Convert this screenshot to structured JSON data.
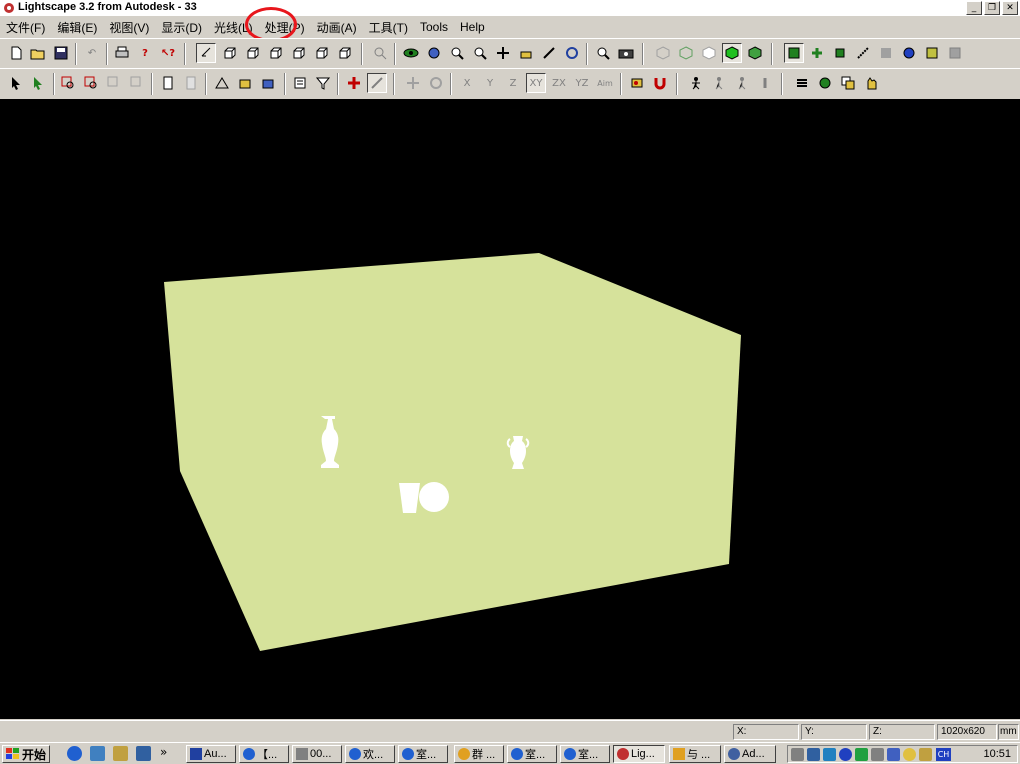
{
  "window": {
    "title": "Lightscape 3.2 from Autodesk - 33",
    "buttons": [
      "_",
      "❐",
      "✕"
    ]
  },
  "menu": [
    {
      "label": "文件(F)"
    },
    {
      "label": "编辑(E)"
    },
    {
      "label": "视图(V)"
    },
    {
      "label": "显示(D)"
    },
    {
      "label": "光线(L)"
    },
    {
      "label": "处理(P)"
    },
    {
      "label": "动画(A)"
    },
    {
      "label": "工具(T)"
    },
    {
      "label": "Tools"
    },
    {
      "label": "Help"
    }
  ],
  "toolbar2_text": {
    "x": "X",
    "y": "Y",
    "z": "Z",
    "xy": "XY",
    "zx": "ZX",
    "yz": "YZ",
    "aim": "Aim"
  },
  "status": {
    "x_label": "X:",
    "y_label": "Y:",
    "z_label": "Z:",
    "resolution": "1020x620",
    "units": "mm"
  },
  "taskbar": {
    "start_label": "开始",
    "quicklaunch_more": "»",
    "tasks": [
      {
        "label": "Au..."
      },
      {
        "label": "【..."
      },
      {
        "label": "00..."
      },
      {
        "label": "欢..."
      },
      {
        "label": "室..."
      },
      {
        "label": "群 ..."
      },
      {
        "label": "室..."
      },
      {
        "label": "室..."
      },
      {
        "label": "Lig..."
      },
      {
        "label": "与 ..."
      },
      {
        "label": "Ad..."
      }
    ],
    "lang": "CH",
    "clock": "10:51"
  },
  "colors": {
    "room": "#d6e29b",
    "viewport_bg": "#000000",
    "highlight": "#e8161c"
  }
}
